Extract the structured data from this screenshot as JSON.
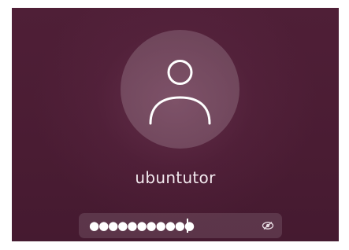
{
  "login": {
    "username": "ubuntutor",
    "password_masked": "●●●●●●●●●●●"
  },
  "icons": {
    "avatar": "user-avatar-icon",
    "reveal": "eye-reveal-password-icon"
  },
  "colors": {
    "background": "#4d1e35",
    "text": "#f2e9ee"
  }
}
